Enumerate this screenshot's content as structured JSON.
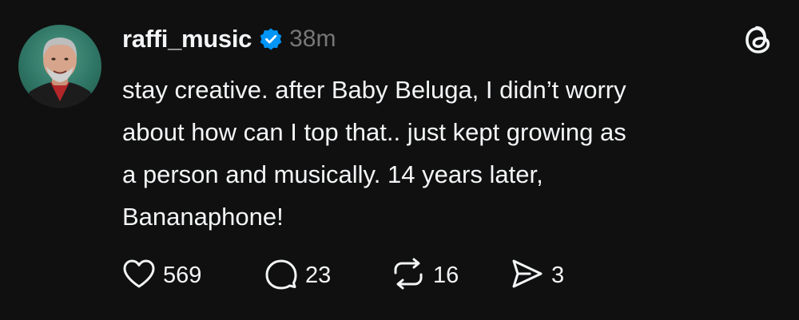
{
  "post": {
    "username": "raffi_music",
    "verified_icon": "verified-badge-icon",
    "timestamp": "38m",
    "text": "stay creative. after Baby Beluga, I didn’t worry\nabout how can I top that.. just kept growing as\na person and musically. 14 years later,\nBananaphone!",
    "app_logo_icon": "threads-logo-icon"
  },
  "actions": {
    "like": {
      "icon": "heart-icon",
      "count": "569"
    },
    "reply": {
      "icon": "comment-icon",
      "count": "23"
    },
    "repost": {
      "icon": "repost-icon",
      "count": "16"
    },
    "share": {
      "icon": "send-icon",
      "count": "3"
    }
  },
  "colors": {
    "background": "#101010",
    "text": "#f3f5f7",
    "muted": "#777777",
    "verified": "#0095f6"
  }
}
